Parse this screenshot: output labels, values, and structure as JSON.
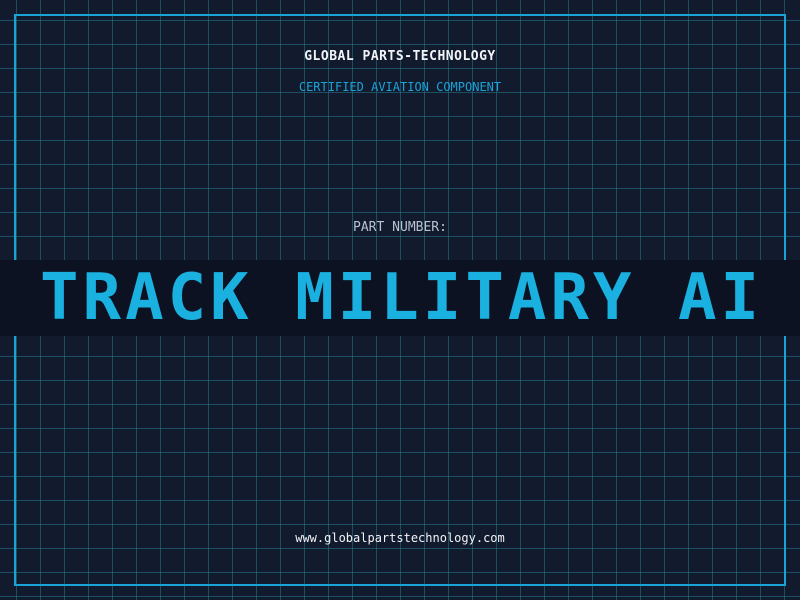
{
  "header": {
    "company": "GLOBAL PARTS-TECHNOLOGY",
    "tagline": "CERTIFIED AVIATION COMPONENT"
  },
  "part": {
    "label": "PART NUMBER:",
    "value": "TRACK MILITARY AI"
  },
  "footer": {
    "website": "www.globalpartstechnology.com"
  },
  "colors": {
    "background": "#121a2e",
    "accent": "#1aa3d6",
    "part_number": "#1ab0e0",
    "text": "#f2f4f8"
  }
}
